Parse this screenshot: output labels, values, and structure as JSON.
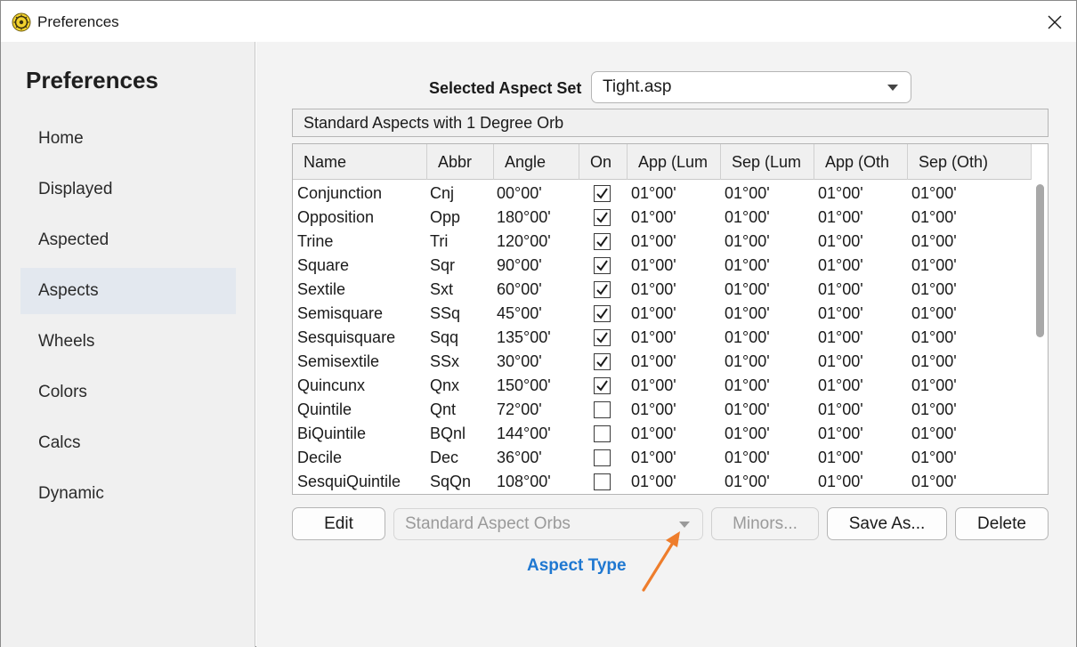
{
  "window": {
    "title": "Preferences"
  },
  "sidebar": {
    "title": "Preferences",
    "items": [
      {
        "label": "Home"
      },
      {
        "label": "Displayed"
      },
      {
        "label": "Aspected"
      },
      {
        "label": "Aspects",
        "selected": true
      },
      {
        "label": "Wheels"
      },
      {
        "label": "Colors"
      },
      {
        "label": "Calcs"
      },
      {
        "label": "Dynamic"
      }
    ]
  },
  "main": {
    "aspect_set_label": "Selected Aspect Set",
    "aspect_set_value": "Tight.asp",
    "description": "Standard Aspects with 1 Degree Orb",
    "table": {
      "columns": [
        "Name",
        "Abbr",
        "Angle",
        "On",
        "App (Lum",
        "Sep (Lum",
        "App (Oth",
        "Sep (Oth)"
      ],
      "rows": [
        {
          "name": "Conjunction",
          "abbr": "Cnj",
          "angle": "00°00'",
          "on": true,
          "app_lum": "01°00'",
          "sep_lum": "01°00'",
          "app_oth": "01°00'",
          "sep_oth": "01°00'"
        },
        {
          "name": "Opposition",
          "abbr": "Opp",
          "angle": "180°00'",
          "on": true,
          "app_lum": "01°00'",
          "sep_lum": "01°00'",
          "app_oth": "01°00'",
          "sep_oth": "01°00'"
        },
        {
          "name": "Trine",
          "abbr": "Tri",
          "angle": "120°00'",
          "on": true,
          "app_lum": "01°00'",
          "sep_lum": "01°00'",
          "app_oth": "01°00'",
          "sep_oth": "01°00'"
        },
        {
          "name": "Square",
          "abbr": "Sqr",
          "angle": "90°00'",
          "on": true,
          "app_lum": "01°00'",
          "sep_lum": "01°00'",
          "app_oth": "01°00'",
          "sep_oth": "01°00'"
        },
        {
          "name": "Sextile",
          "abbr": "Sxt",
          "angle": "60°00'",
          "on": true,
          "app_lum": "01°00'",
          "sep_lum": "01°00'",
          "app_oth": "01°00'",
          "sep_oth": "01°00'"
        },
        {
          "name": "Semisquare",
          "abbr": "SSq",
          "angle": "45°00'",
          "on": true,
          "app_lum": "01°00'",
          "sep_lum": "01°00'",
          "app_oth": "01°00'",
          "sep_oth": "01°00'"
        },
        {
          "name": "Sesquisquare",
          "abbr": "Sqq",
          "angle": "135°00'",
          "on": true,
          "app_lum": "01°00'",
          "sep_lum": "01°00'",
          "app_oth": "01°00'",
          "sep_oth": "01°00'"
        },
        {
          "name": "Semisextile",
          "abbr": "SSx",
          "angle": "30°00'",
          "on": true,
          "app_lum": "01°00'",
          "sep_lum": "01°00'",
          "app_oth": "01°00'",
          "sep_oth": "01°00'"
        },
        {
          "name": "Quincunx",
          "abbr": "Qnx",
          "angle": "150°00'",
          "on": true,
          "app_lum": "01°00'",
          "sep_lum": "01°00'",
          "app_oth": "01°00'",
          "sep_oth": "01°00'"
        },
        {
          "name": "Quintile",
          "abbr": "Qnt",
          "angle": "72°00'",
          "on": false,
          "app_lum": "01°00'",
          "sep_lum": "01°00'",
          "app_oth": "01°00'",
          "sep_oth": "01°00'"
        },
        {
          "name": "BiQuintile",
          "abbr": "BQnl",
          "angle": "144°00'",
          "on": false,
          "app_lum": "01°00'",
          "sep_lum": "01°00'",
          "app_oth": "01°00'",
          "sep_oth": "01°00'"
        },
        {
          "name": "Decile",
          "abbr": "Dec",
          "angle": "36°00'",
          "on": false,
          "app_lum": "01°00'",
          "sep_lum": "01°00'",
          "app_oth": "01°00'",
          "sep_oth": "01°00'"
        },
        {
          "name": "SesquiQuintile",
          "abbr": "SqQn",
          "angle": "108°00'",
          "on": false,
          "app_lum": "01°00'",
          "sep_lum": "01°00'",
          "app_oth": "01°00'",
          "sep_oth": "01°00'"
        }
      ]
    },
    "buttons": {
      "edit": "Edit",
      "aspect_type_value": "Standard Aspect Orbs",
      "minors": "Minors...",
      "save_as": "Save As...",
      "delete": "Delete"
    },
    "annotation": {
      "label": "Aspect Type",
      "color": "#1f78d1",
      "arrow_color": "#ee7d2c"
    }
  }
}
